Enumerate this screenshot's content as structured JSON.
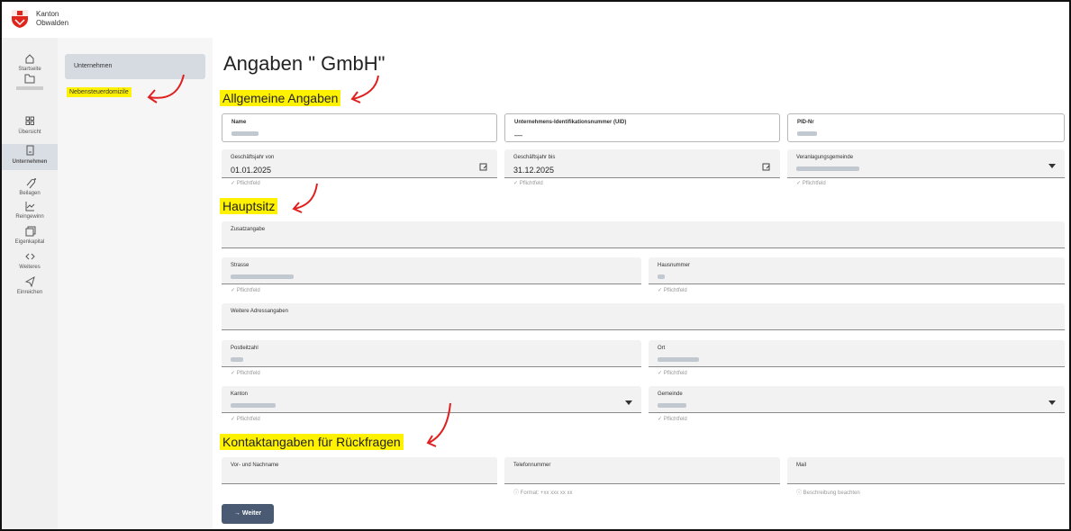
{
  "brand": {
    "line1": "Kanton",
    "line2": "Obwalden"
  },
  "nav": [
    {
      "label": "Startseite",
      "icon": "home-icon"
    },
    {
      "label": "",
      "icon": "folder-icon"
    },
    {
      "label": "Übersicht",
      "icon": "grid-icon"
    },
    {
      "label": "Unternehmen",
      "icon": "document-icon"
    },
    {
      "label": "Beilagen",
      "icon": "attachment-icon"
    },
    {
      "label": "Reingewinn",
      "icon": "chart-icon"
    },
    {
      "label": "Eigenkapital",
      "icon": "capital-icon"
    },
    {
      "label": "Weiteres",
      "icon": "more-icon"
    },
    {
      "label": "Einreichen",
      "icon": "send-icon"
    }
  ],
  "sub": {
    "item1": "Unternehmen",
    "item2": "Nebensteuerdomizile"
  },
  "page": {
    "title": "Angaben \"   GmbH\""
  },
  "sections": {
    "general": "Allgemeine Angaben",
    "hq": "Hauptsitz",
    "contact": "Kontaktangaben für Rückfragen"
  },
  "fields": {
    "name": "Name",
    "uid": "Unternehmens-Identifikationsnummer (UID)",
    "uid_value": "—",
    "pid": "PID-Nr",
    "gj_von": "Geschäftsjahr von",
    "gj_von_value": "01.01.2025",
    "gj_bis": "Geschäftsjahr bis",
    "gj_bis_value": "31.12.2025",
    "veranlagung": "Veranlagungsgemeinde",
    "zusatz": "Zusatzangabe",
    "strasse": "Strasse",
    "hausnummer": "Hausnummer",
    "weitere": "Weitere Adressangaben",
    "plz": "Postleitzahl",
    "ort": "Ort",
    "kanton": "Kanton",
    "gemeinde": "Gemeinde",
    "kontakt_name": "Vor- und Nachname",
    "telefon": "Telefonnummer",
    "mail": "Mail"
  },
  "hints": {
    "required": "✓ Pflichtfeld",
    "phone": "ⓘ Format: +xx xxx xx xx",
    "mail": "ⓘ Beschreibung beachten"
  },
  "button": {
    "next": "→  Weiter"
  }
}
